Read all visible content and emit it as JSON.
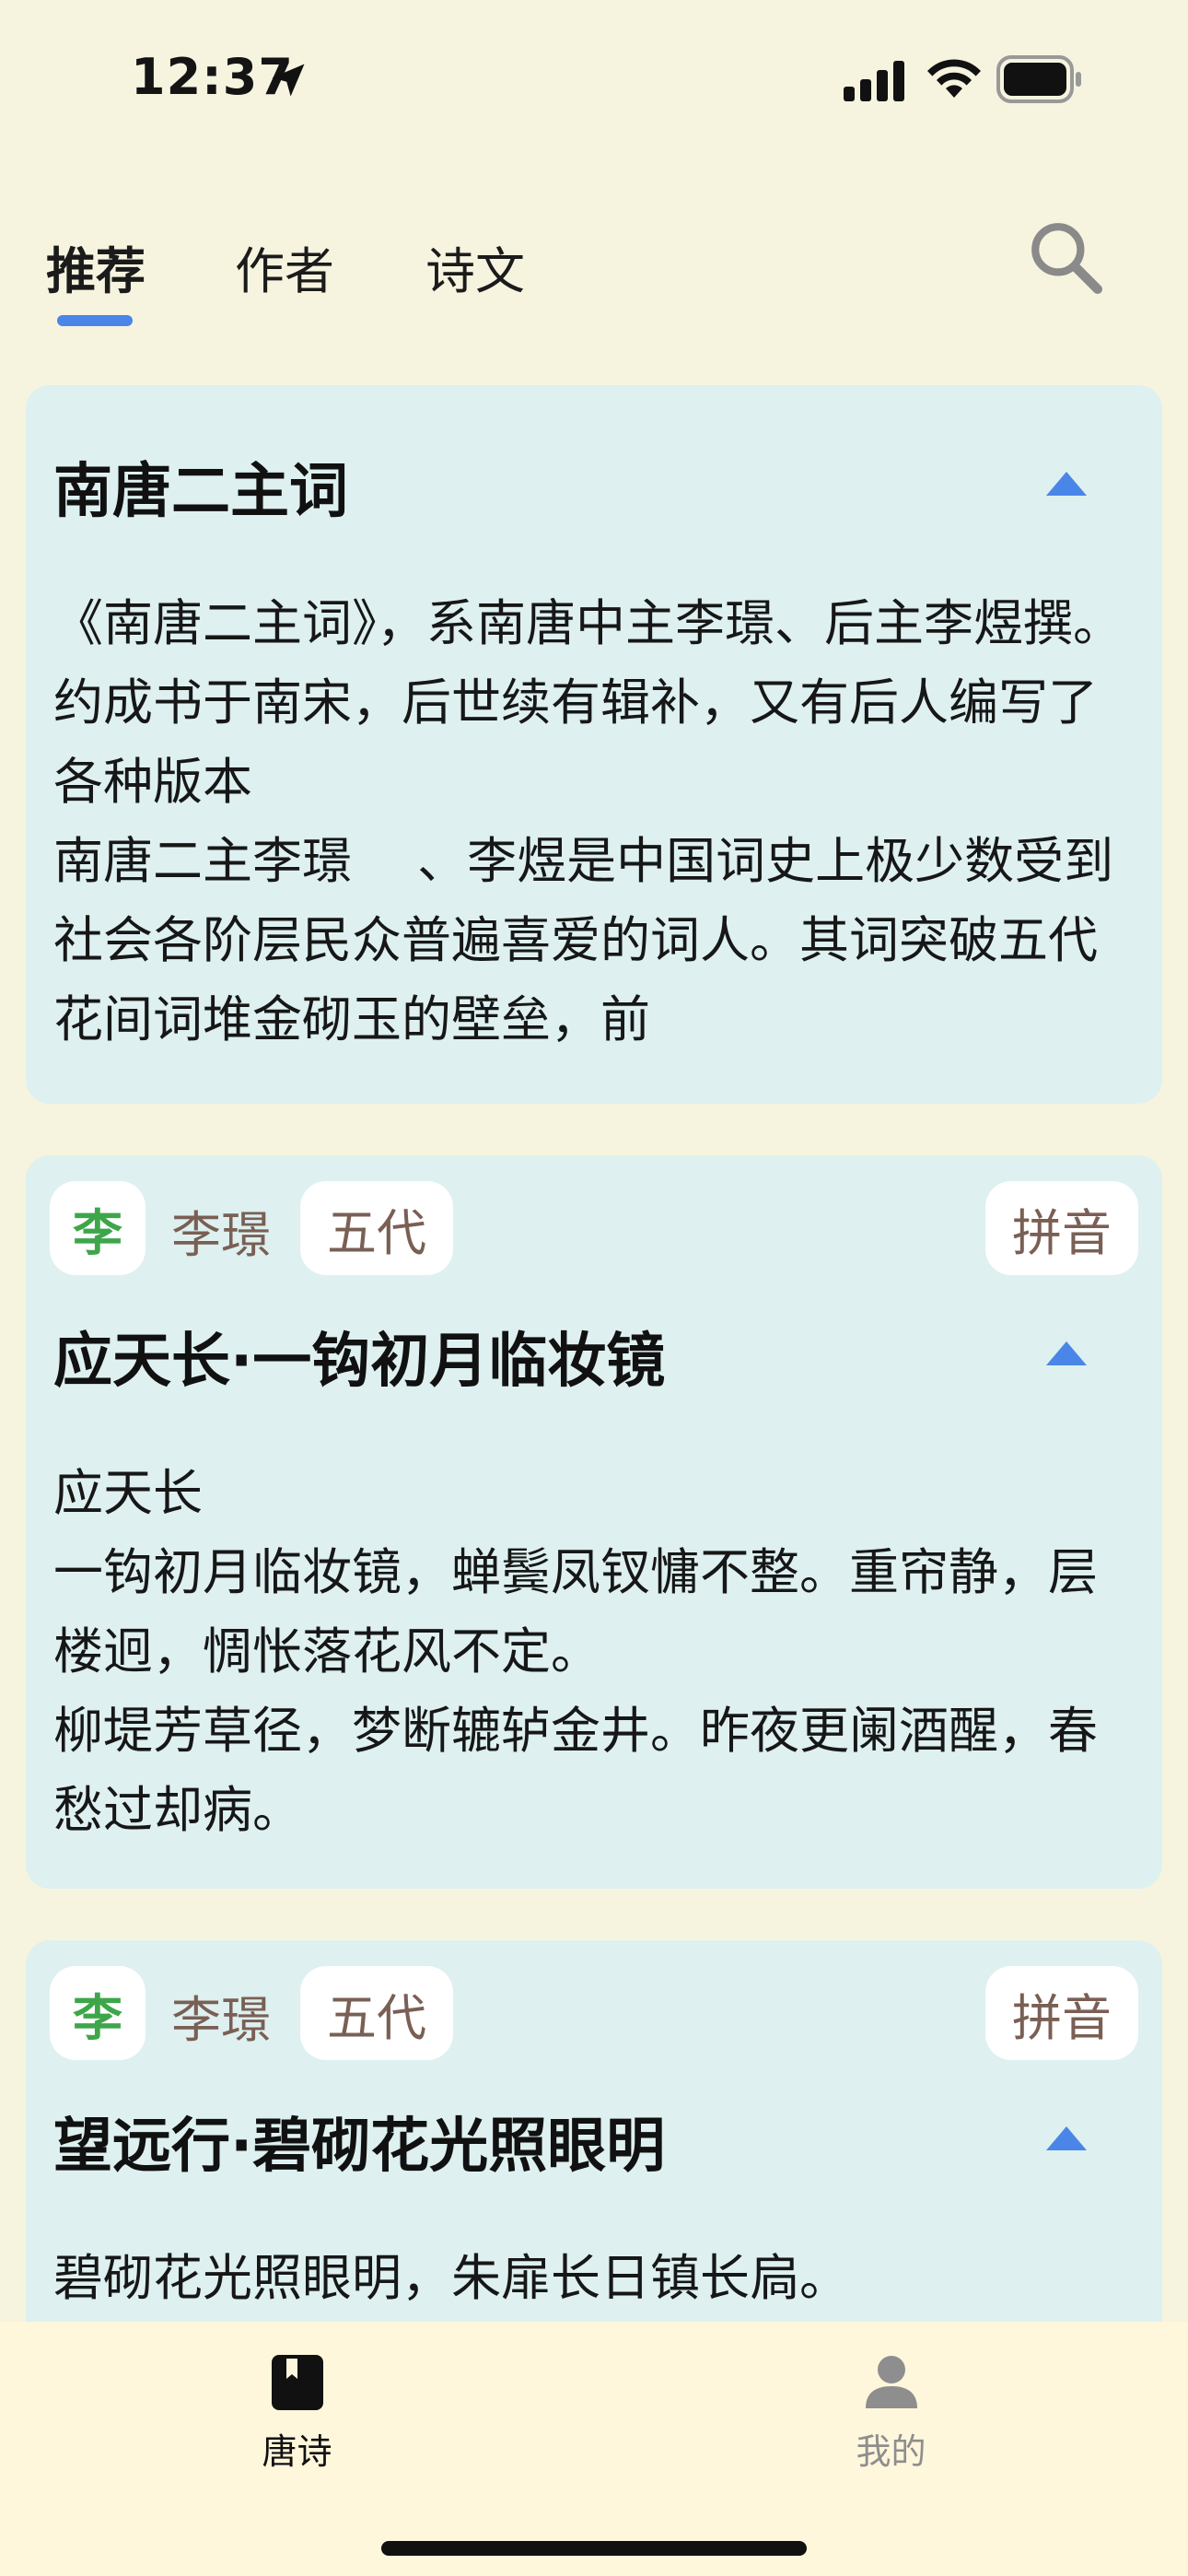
{
  "status": {
    "time": "12:37"
  },
  "top_tabs": [
    {
      "label": "推荐",
      "active": true
    },
    {
      "label": "作者",
      "active": false
    },
    {
      "label": "诗文",
      "active": false
    }
  ],
  "cards": [
    {
      "title": "南唐二主词",
      "body": "《南唐二主词》，系南唐中主李璟、后主李煜撰。约成书于南宋，后世续有辑补，又有后人编写了各种版本\n南唐二主李璟 　、李煜是中国词史上极少数受到社会各阶层民众普遍喜爱的词人。其词突破五代花间词堆金砌玉的壁垒，前"
    },
    {
      "author_initial": "李",
      "author": "李璟",
      "dynasty": "五代",
      "pinyin_label": "拼音",
      "title": "应天长·一钩初月临妆镜",
      "body": "应天长\n一钩初月临妆镜，蝉鬓凤钗慵不整。重帘静，层楼迥，惆怅落花风不定。\n柳堤芳草径，梦断辘轳金井。昨夜更阑酒醒，春愁过却病。"
    },
    {
      "author_initial": "李",
      "author": "李璟",
      "dynasty": "五代",
      "pinyin_label": "拼音",
      "title": "望远行·碧砌花光照眼明",
      "body": "碧砌花光照眼明，朱扉长日镇长扃。"
    }
  ],
  "bottom_nav": [
    {
      "label": "唐诗",
      "active": true,
      "icon": "book-icon"
    },
    {
      "label": "我的",
      "active": false,
      "icon": "person-icon"
    }
  ],
  "colors": {
    "accent": "#4a86e8",
    "card_bg": "#def0f0",
    "page_bg": "#f6f4df",
    "tag_green": "#3ea64a",
    "tag_brown": "#7a5f54"
  }
}
